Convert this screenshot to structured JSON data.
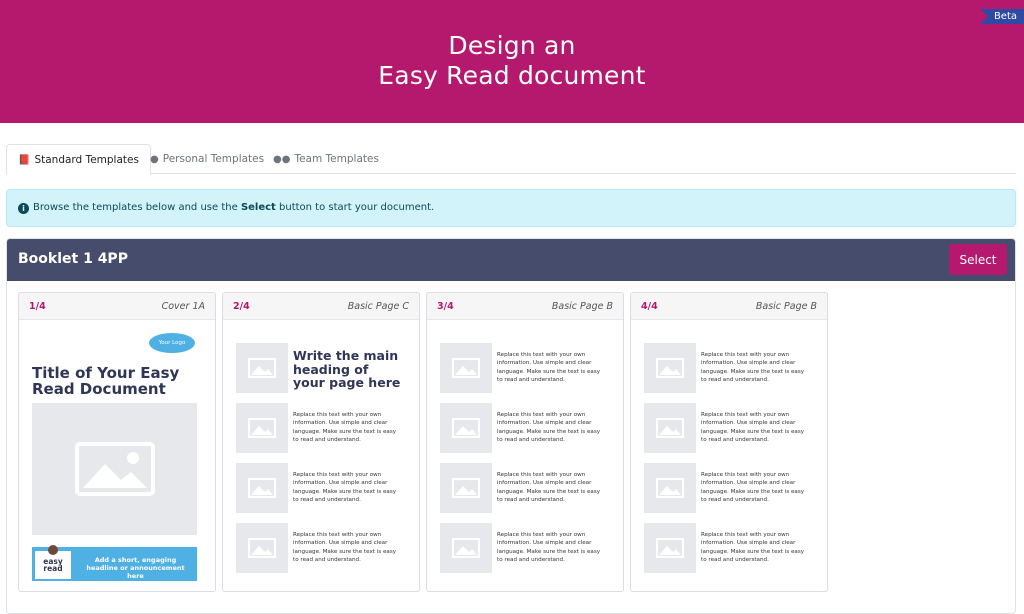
{
  "header": {
    "title_line1": "Design an",
    "title_line2": "Easy Read document",
    "beta_label": "Beta"
  },
  "tabs": [
    {
      "icon": "book-icon",
      "label": "Standard Templates",
      "active": true
    },
    {
      "icon": "user-icon",
      "label": "Personal Templates",
      "active": false
    },
    {
      "icon": "users-icon",
      "label": "Team Templates",
      "active": false
    }
  ],
  "alert": {
    "text_before": "Browse the templates below and use the ",
    "bold": "Select",
    "text_after": " button to start your document."
  },
  "template": {
    "name": "Booklet 1 4PP",
    "select_label": "Select",
    "pages": [
      {
        "number": "1/4",
        "name": "Cover 1A"
      },
      {
        "number": "2/4",
        "name": "Basic Page C"
      },
      {
        "number": "3/4",
        "name": "Basic Page B"
      },
      {
        "number": "4/4",
        "name": "Basic Page B"
      }
    ],
    "cover": {
      "logo": "Your Logo",
      "title": "Title of Your Easy Read Document",
      "banner": "Add a short, engaging headline or announcement here",
      "badge_line1": "easy",
      "badge_line2": "read"
    },
    "heading_text": "Write the main heading of your page here",
    "body_text": "Replace this text with your own information. Use simple and clear language. Make sure the text is easy to read and understand."
  }
}
